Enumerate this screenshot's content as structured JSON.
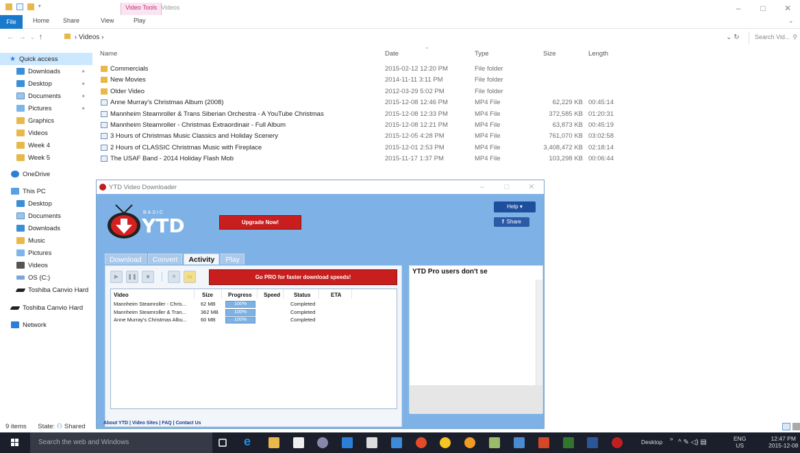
{
  "explorer": {
    "contextual_tab": "Video Tools",
    "window_title": "Videos",
    "ribbon_tabs": [
      "File",
      "Home",
      "Share",
      "View",
      "Play"
    ],
    "path": "Videos",
    "search_placeholder": "Search Vid...",
    "columns": [
      "Name",
      "Date",
      "Type",
      "Size",
      "Length"
    ],
    "nav": {
      "quick_access": "Quick access",
      "qa_items": [
        "Downloads",
        "Desktop",
        "Documents",
        "Pictures",
        "Graphics",
        "Videos",
        "Week 4",
        "Week 5"
      ],
      "onedrive": "OneDrive",
      "this_pc": "This PC",
      "pc_items": [
        "Desktop",
        "Documents",
        "Downloads",
        "Music",
        "Pictures",
        "Videos",
        "OS (C:)",
        "Toshiba Canvio Hard"
      ],
      "toshiba": "Toshiba Canvio Hard",
      "network": "Network"
    },
    "files": [
      {
        "name": "Commercials",
        "date": "2015-02-12 12:20 PM",
        "type": "File folder",
        "size": "",
        "length": "",
        "kind": "folder"
      },
      {
        "name": "New Movies",
        "date": "2014-11-11 3:11 PM",
        "type": "File folder",
        "size": "",
        "length": "",
        "kind": "folder"
      },
      {
        "name": "Older Video",
        "date": "2012-03-29 5:02 PM",
        "type": "File folder",
        "size": "",
        "length": "",
        "kind": "folder"
      },
      {
        "name": "Anne Murray's Christmas Album (2008)",
        "date": "2015-12-08 12:46 PM",
        "type": "MP4 File",
        "size": "62,229 KB",
        "length": "00:45:14",
        "kind": "video"
      },
      {
        "name": "Mannheim Steamroller & Trans Siberian Orchestra - A YouTube Christmas",
        "date": "2015-12-08 12:33 PM",
        "type": "MP4 File",
        "size": "372,585 KB",
        "length": "01:20:31",
        "kind": "video"
      },
      {
        "name": "Mannheim Steamroller - Christmas Extraordinair - Full Album",
        "date": "2015-12-08 12:21 PM",
        "type": "MP4 File",
        "size": "63,873 KB",
        "length": "00:45:19",
        "kind": "video"
      },
      {
        "name": "3 Hours of Christmas Music Classics and Holiday Scenery",
        "date": "2015-12-05 4:28 PM",
        "type": "MP4 File",
        "size": "761,070 KB",
        "length": "03:02:58",
        "kind": "video"
      },
      {
        "name": "2 Hours of CLASSIC Christmas Music with Fireplace",
        "date": "2015-12-01 2:53 PM",
        "type": "MP4 File",
        "size": "3,408,472 KB",
        "length": "02:18:14",
        "kind": "video"
      },
      {
        "name": "The USAF Band - 2014 Holiday Flash Mob",
        "date": "2015-11-17 1:37 PM",
        "type": "MP4 File",
        "size": "103,298 KB",
        "length": "00:06:44",
        "kind": "video"
      }
    ],
    "status_count": "9 items",
    "status_state": "State:",
    "status_shared": "Shared"
  },
  "ytd": {
    "title": "YTD Video Downloader",
    "logo_small": "BASIC",
    "logo_big": "YTD",
    "upgrade": "Upgrade Now!",
    "help": "Help ▾",
    "share": "Share",
    "tabs": [
      "Download",
      "Convert",
      "Activity",
      "Play"
    ],
    "gopro": "Go PRO for faster download speeds!",
    "table_headers": [
      "Video",
      "Size",
      "Progress",
      "Speed",
      "Status",
      "ETA"
    ],
    "rows": [
      {
        "video": "Mannheim Steamroller - Chris...",
        "size": "62 MB",
        "progress": "100%",
        "progress_value": 100,
        "status": "Completed"
      },
      {
        "video": "Mannheim Steamroller & Tran...",
        "size": "362 MB",
        "progress": "100%",
        "progress_value": 100,
        "status": "Completed"
      },
      {
        "video": "Anne Murray's Christmas Albu...",
        "size": "60 MB",
        "progress": "100%",
        "progress_value": 100,
        "status": "Completed"
      }
    ],
    "links": "About YTD | Video Sites | FAQ | Contact Us",
    "promo_title": "YTD Pro users don't se"
  },
  "taskbar": {
    "search_placeholder": "Search the web and Windows",
    "desktop": "Desktop",
    "lang": "ENG",
    "region": "US",
    "time": "12:47 PM",
    "date": "2015-12-08"
  },
  "colors": {
    "accent": "#1979ca",
    "ytd_bg": "#7eb2e6",
    "ytd_red": "#c81e1e",
    "folder": "#e8b84a",
    "taskbar": "#1b1f2b"
  }
}
